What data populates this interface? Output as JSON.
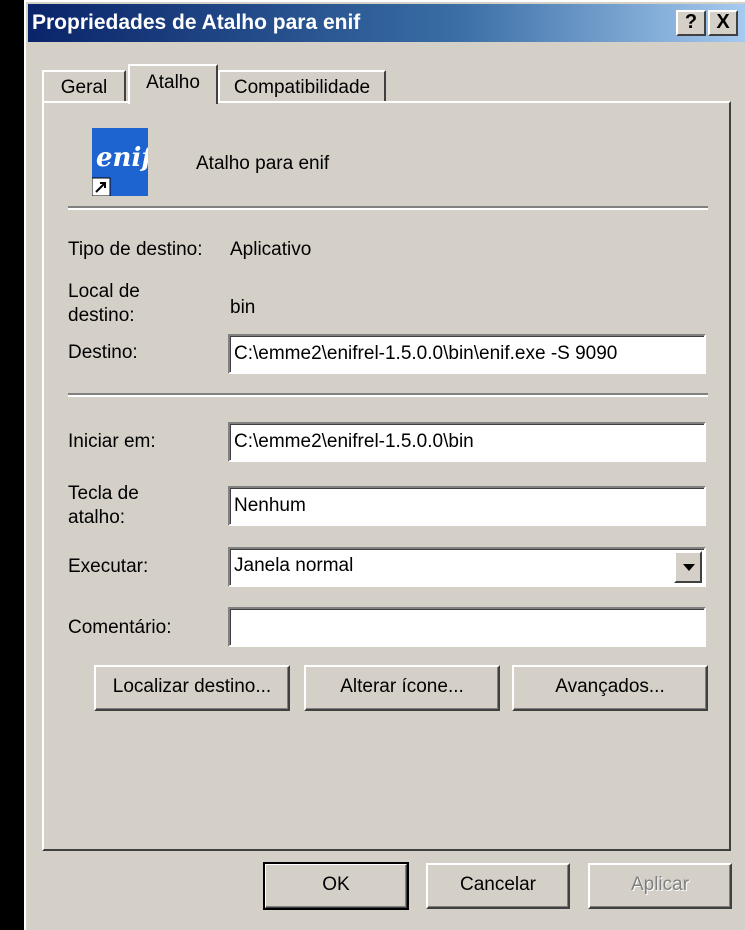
{
  "window": {
    "title": "Propriedades de Atalho para enif",
    "help_button": "?",
    "close_button": "X"
  },
  "tabs": [
    {
      "label": "Geral",
      "active": false
    },
    {
      "label": "Atalho",
      "active": true
    },
    {
      "label": "Compatibilidade",
      "active": false
    }
  ],
  "shortcut": {
    "icon_text": "enif",
    "name": "Atalho para enif",
    "target_type_label": "Tipo de destino:",
    "target_type_value": "Aplicativo",
    "target_location_label_1": "Local de",
    "target_location_label_2": "destino:",
    "target_location_value": "bin",
    "target_label": "Destino:",
    "target_value": "C:\\emme2\\enifrel-1.5.0.0\\bin\\enif.exe -S 9090",
    "start_in_label": "Iniciar em:",
    "start_in_value": "C:\\emme2\\enifrel-1.5.0.0\\bin",
    "hotkey_label_1": "Tecla de",
    "hotkey_label_2": "atalho:",
    "hotkey_value": "Nenhum",
    "run_label": "Executar:",
    "run_value": "Janela normal",
    "comment_label": "Comentário:",
    "comment_value": ""
  },
  "actions": {
    "find_target": "Localizar destino...",
    "change_icon": "Alterar ícone...",
    "advanced": "Avançados..."
  },
  "footer": {
    "ok": "OK",
    "cancel": "Cancelar",
    "apply": "Aplicar"
  },
  "colors": {
    "title_bar_start": "#0a246a",
    "title_bar_end": "#a6caf0",
    "face": "#d4d0c8",
    "icon_blue": "#1e64d0"
  }
}
